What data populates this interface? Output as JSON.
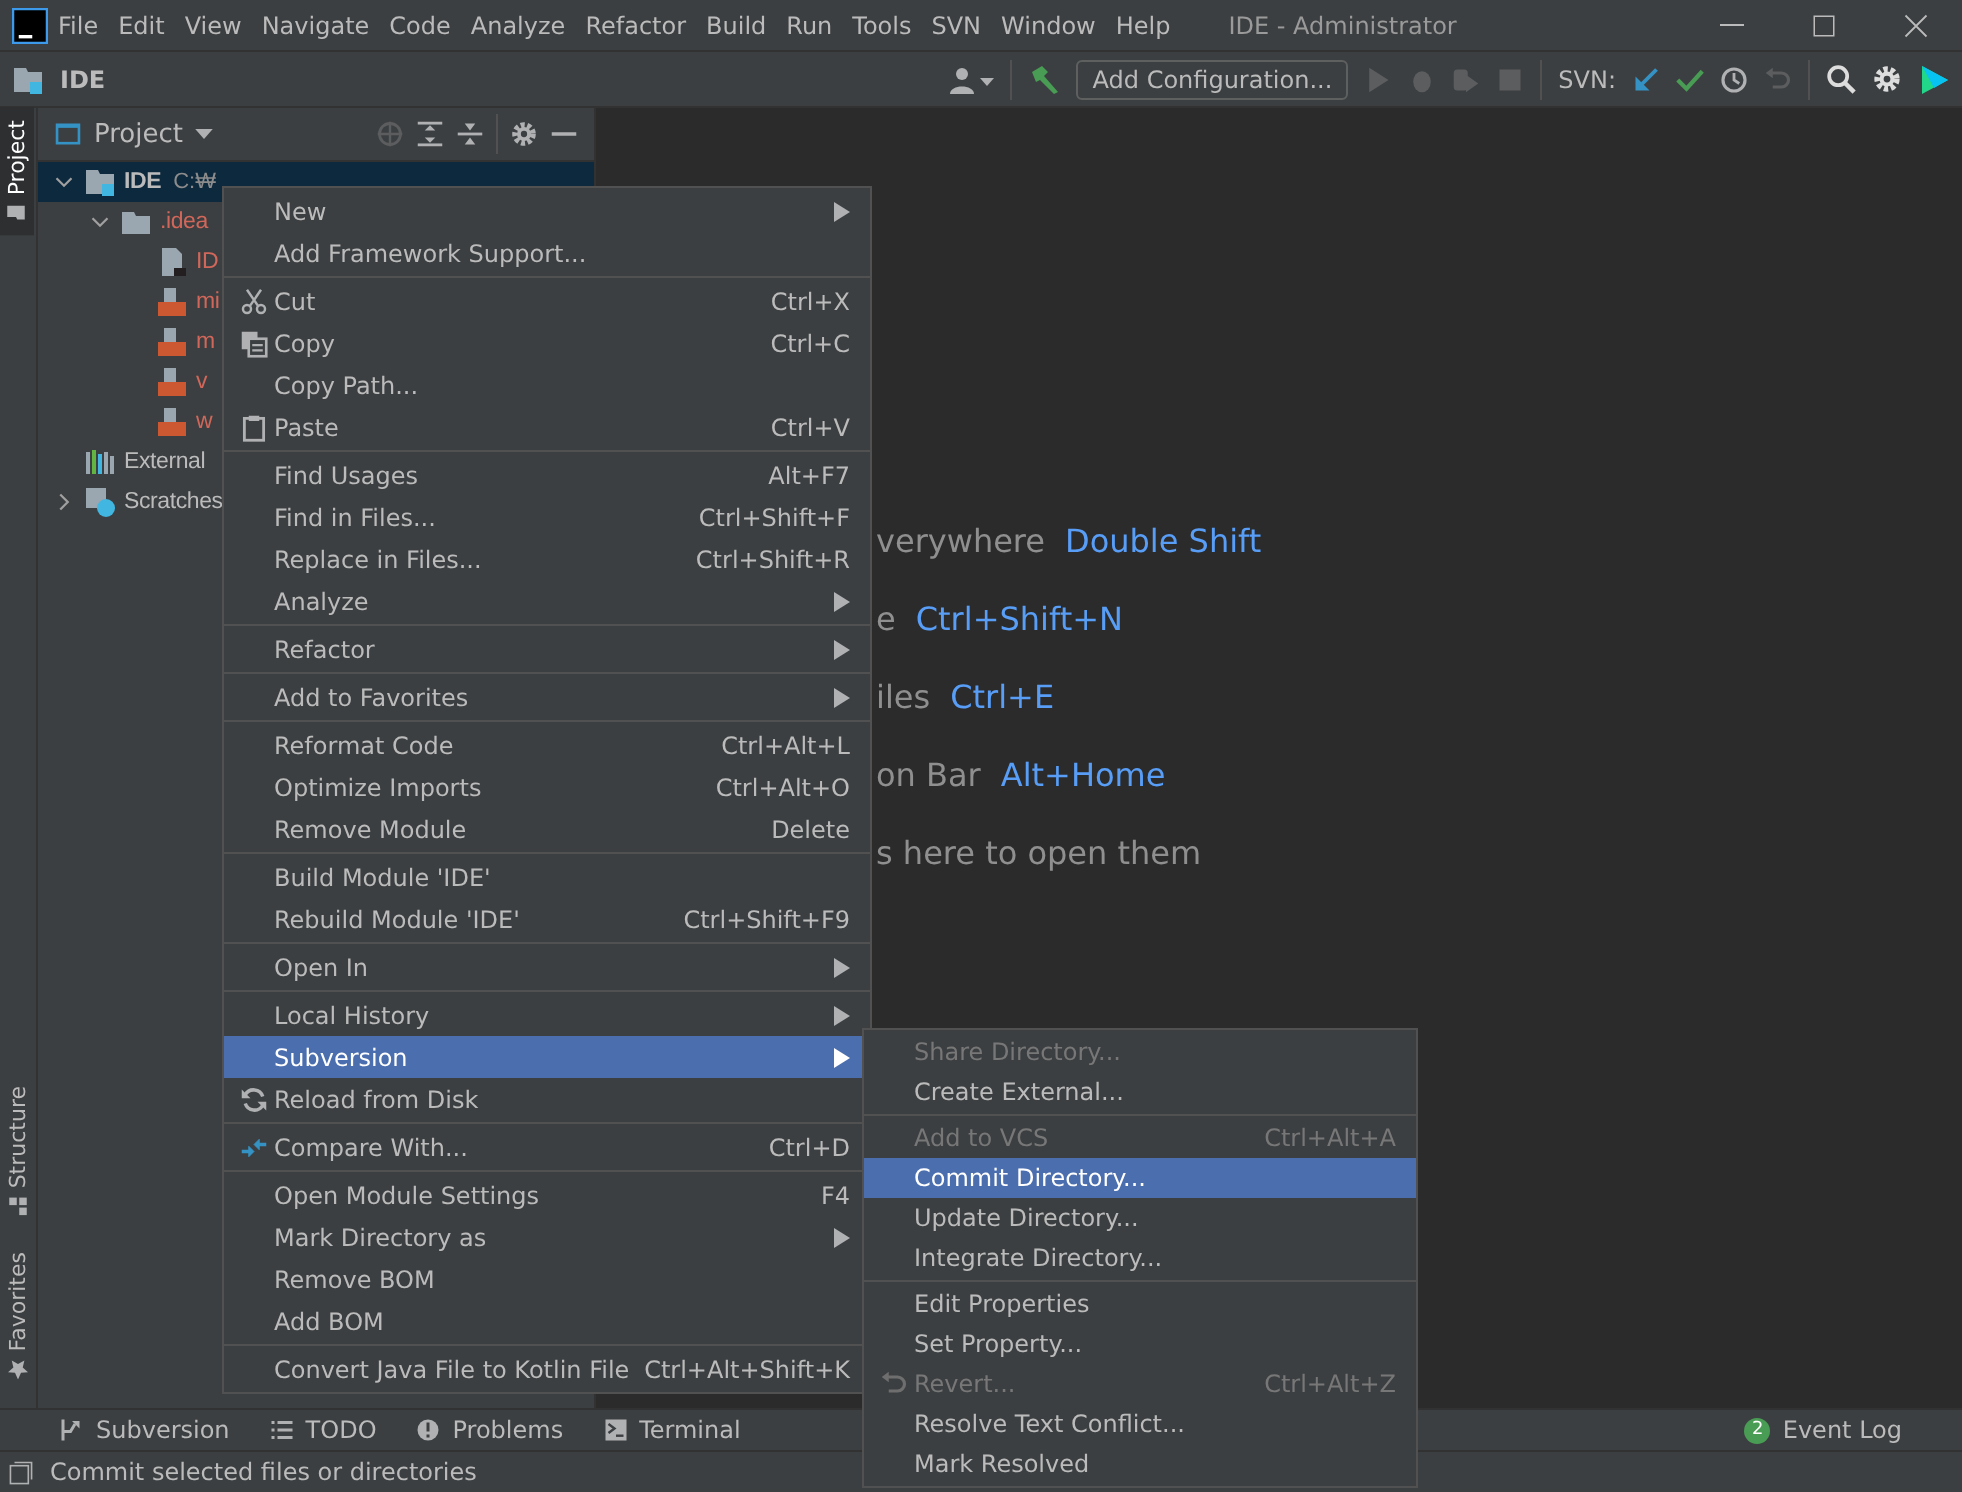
{
  "window": {
    "title": "IDE - Administrator"
  },
  "menu_bar": [
    "File",
    "Edit",
    "View",
    "Navigate",
    "Code",
    "Analyze",
    "Refactor",
    "Build",
    "Run",
    "Tools",
    "SVN",
    "Window",
    "Help"
  ],
  "toolbar": {
    "project": "IDE",
    "configuration_button": "Add Configuration...",
    "svn_label": "SVN:"
  },
  "side_tabs": [
    {
      "label": "Project",
      "selected": true
    },
    {
      "label": "Structure",
      "selected": false
    },
    {
      "label": "Favorites",
      "selected": false
    }
  ],
  "project_panel": {
    "title": "Project",
    "tree": [
      {
        "label": "IDE",
        "path": "C:₩",
        "kind": "module",
        "expanded": true,
        "selected": true,
        "unversioned": false,
        "children": [
          {
            "label": ".idea",
            "kind": "folder",
            "expanded": true,
            "selected": false,
            "unversioned": true,
            "children": [
              {
                "label": "ID",
                "kind": "config",
                "selected": false,
                "unversioned": true
              },
              {
                "label": "mi",
                "kind": "xml",
                "selected": false,
                "unversioned": true
              },
              {
                "label": "m",
                "kind": "xml",
                "selected": false,
                "unversioned": true
              },
              {
                "label": "v",
                "kind": "xml",
                "selected": false,
                "unversioned": true
              },
              {
                "label": "w",
                "kind": "xml",
                "selected": false,
                "unversioned": true
              }
            ]
          }
        ]
      },
      {
        "label": "External",
        "kind": "libraries",
        "selected": false,
        "unversioned": false
      },
      {
        "label": "Scratches",
        "kind": "scratches",
        "expanded": false,
        "selected": false,
        "unversioned": false
      }
    ]
  },
  "editor_hints": [
    {
      "text": "verywhere",
      "shortcut": "Double Shift"
    },
    {
      "text": "e",
      "shortcut": "Ctrl+Shift+N"
    },
    {
      "text": "iles",
      "shortcut": "Ctrl+E"
    },
    {
      "text": "on Bar",
      "shortcut": "Alt+Home"
    },
    {
      "text": "s here to open them"
    }
  ],
  "context_menu": [
    {
      "kind": "item",
      "label": "New",
      "submenu": true,
      "selected": false,
      "disabled": false
    },
    {
      "kind": "item",
      "label": "Add Framework Support...",
      "selected": false,
      "disabled": false
    },
    {
      "kind": "separator"
    },
    {
      "kind": "item",
      "label": "Cut",
      "shortcut": "Ctrl+X",
      "selected": false,
      "disabled": false
    },
    {
      "kind": "item",
      "label": "Copy",
      "shortcut": "Ctrl+C",
      "selected": false,
      "disabled": false
    },
    {
      "kind": "item",
      "label": "Copy Path...",
      "selected": false,
      "disabled": false
    },
    {
      "kind": "item",
      "label": "Paste",
      "shortcut": "Ctrl+V",
      "selected": false,
      "disabled": false
    },
    {
      "kind": "separator"
    },
    {
      "kind": "item",
      "label": "Find Usages",
      "shortcut": "Alt+F7",
      "selected": false,
      "disabled": false
    },
    {
      "kind": "item",
      "label": "Find in Files...",
      "shortcut": "Ctrl+Shift+F",
      "selected": false,
      "disabled": false
    },
    {
      "kind": "item",
      "label": "Replace in Files...",
      "shortcut": "Ctrl+Shift+R",
      "selected": false,
      "disabled": false
    },
    {
      "kind": "item",
      "label": "Analyze",
      "submenu": true,
      "selected": false,
      "disabled": false
    },
    {
      "kind": "separator"
    },
    {
      "kind": "item",
      "label": "Refactor",
      "submenu": true,
      "selected": false,
      "disabled": false
    },
    {
      "kind": "separator"
    },
    {
      "kind": "item",
      "label": "Add to Favorites",
      "submenu": true,
      "selected": false,
      "disabled": false
    },
    {
      "kind": "separator"
    },
    {
      "kind": "item",
      "label": "Reformat Code",
      "shortcut": "Ctrl+Alt+L",
      "selected": false,
      "disabled": false
    },
    {
      "kind": "item",
      "label": "Optimize Imports",
      "shortcut": "Ctrl+Alt+O",
      "selected": false,
      "disabled": false
    },
    {
      "kind": "item",
      "label": "Remove Module",
      "shortcut": "Delete",
      "selected": false,
      "disabled": false
    },
    {
      "kind": "separator"
    },
    {
      "kind": "item",
      "label": "Build Module 'IDE'",
      "selected": false,
      "disabled": false
    },
    {
      "kind": "item",
      "label": "Rebuild Module 'IDE'",
      "shortcut": "Ctrl+Shift+F9",
      "selected": false,
      "disabled": false
    },
    {
      "kind": "separator"
    },
    {
      "kind": "item",
      "label": "Open In",
      "submenu": true,
      "selected": false,
      "disabled": false
    },
    {
      "kind": "separator"
    },
    {
      "kind": "item",
      "label": "Local History",
      "submenu": true,
      "selected": false,
      "disabled": false
    },
    {
      "kind": "item",
      "label": "Subversion",
      "submenu": true,
      "selected": true,
      "disabled": false
    },
    {
      "kind": "item",
      "label": "Reload from Disk",
      "selected": false,
      "disabled": false
    },
    {
      "kind": "separator"
    },
    {
      "kind": "item",
      "label": "Compare With...",
      "shortcut": "Ctrl+D",
      "selected": false,
      "disabled": false
    },
    {
      "kind": "separator"
    },
    {
      "kind": "item",
      "label": "Open Module Settings",
      "shortcut": "F4",
      "selected": false,
      "disabled": false
    },
    {
      "kind": "item",
      "label": "Mark Directory as",
      "submenu": true,
      "selected": false,
      "disabled": false
    },
    {
      "kind": "item",
      "label": "Remove BOM",
      "selected": false,
      "disabled": false
    },
    {
      "kind": "item",
      "label": "Add BOM",
      "selected": false,
      "disabled": false
    },
    {
      "kind": "separator"
    },
    {
      "kind": "item",
      "label": "Convert Java File to Kotlin File",
      "shortcut": "Ctrl+Alt+Shift+K",
      "selected": false,
      "disabled": false
    }
  ],
  "submenu": [
    {
      "kind": "item",
      "label": "Share Directory...",
      "selected": false,
      "disabled": true
    },
    {
      "kind": "item",
      "label": "Create External...",
      "selected": false,
      "disabled": false
    },
    {
      "kind": "separator"
    },
    {
      "kind": "item",
      "label": "Add to VCS",
      "shortcut": "Ctrl+Alt+A",
      "selected": false,
      "disabled": true
    },
    {
      "kind": "item",
      "label": "Commit Directory...",
      "selected": true,
      "disabled": false
    },
    {
      "kind": "item",
      "label": "Update Directory...",
      "selected": false,
      "disabled": false
    },
    {
      "kind": "item",
      "label": "Integrate Directory...",
      "selected": false,
      "disabled": false
    },
    {
      "kind": "separator"
    },
    {
      "kind": "item",
      "label": "Edit Properties",
      "selected": false,
      "disabled": false
    },
    {
      "kind": "item",
      "label": "Set Property...",
      "selected": false,
      "disabled": false
    },
    {
      "kind": "item",
      "label": "Revert...",
      "shortcut": "Ctrl+Alt+Z",
      "selected": false,
      "disabled": true
    },
    {
      "kind": "item",
      "label": "Resolve Text Conflict...",
      "selected": false,
      "disabled": false
    },
    {
      "kind": "item",
      "label": "Mark Resolved",
      "selected": false,
      "disabled": false
    }
  ],
  "tool_windows": [
    {
      "label": "Subversion"
    },
    {
      "label": "TODO"
    },
    {
      "label": "Problems"
    },
    {
      "label": "Terminal"
    }
  ],
  "event_log": {
    "count": "2",
    "label": "Event Log"
  },
  "status_bar": {
    "message": "Commit selected files or directories"
  }
}
